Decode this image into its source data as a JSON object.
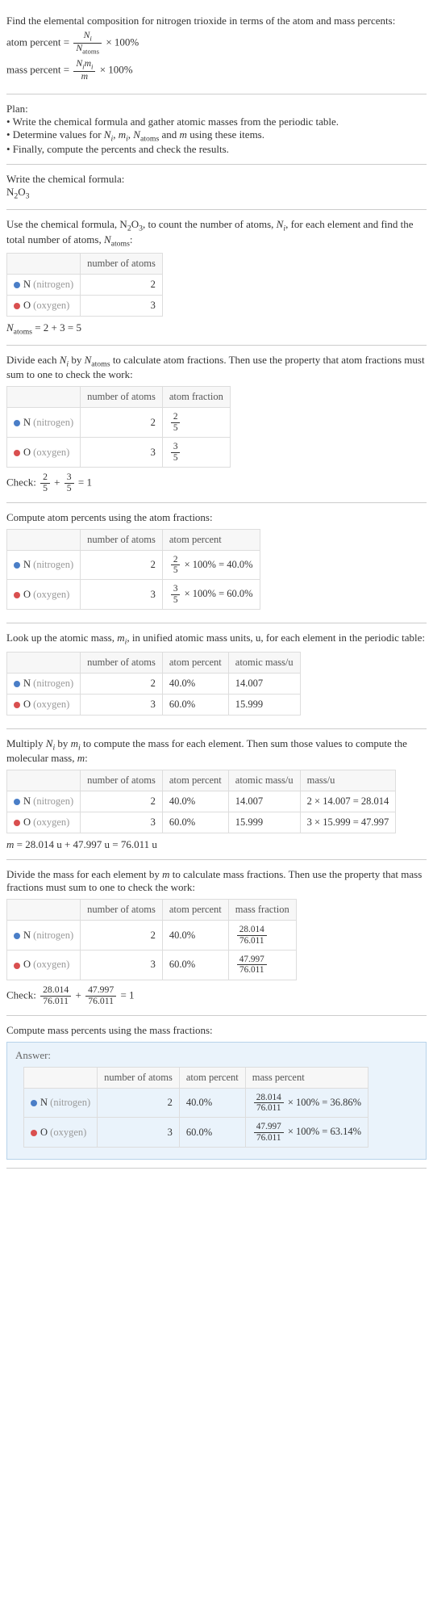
{
  "intro": {
    "line1": "Find the elemental composition for nitrogen trioxide in terms of the atom and mass percents:",
    "atom_percent_label": "atom percent = ",
    "atom_percent_frac_num": "N",
    "atom_percent_frac_den": "N",
    "times_hundred": " × 100%",
    "mass_percent_label": "mass percent = ",
    "mass_percent_frac_num": "N",
    "mass_percent_frac_den": "m"
  },
  "plan": {
    "title": "Plan:",
    "b1": "• Write the chemical formula and gather atomic masses from the periodic table.",
    "b2_a": "• Determine values for ",
    "b2_b": " using these items.",
    "b3": "• Finally, compute the percents and check the results."
  },
  "s1": {
    "title": "Write the chemical formula:",
    "formula_n": "N",
    "formula_n_sub": "2",
    "formula_o": "O",
    "formula_o_sub": "3"
  },
  "s2": {
    "intro_a": "Use the chemical formula, N",
    "intro_b": "O",
    "intro_c": ", to count the number of atoms, ",
    "intro_d": ", for each element and find the total number of atoms, ",
    "intro_e": ":",
    "h_num": "number of atoms",
    "row_n_sym": "N",
    "row_n_name": "(nitrogen)",
    "row_n_val": "2",
    "row_o_sym": "O",
    "row_o_name": "(oxygen)",
    "row_o_val": "3",
    "total_a": " = 2 + 3 = 5"
  },
  "s3": {
    "intro_a": "Divide each ",
    "intro_b": " by ",
    "intro_c": " to calculate atom fractions. Then use the property that atom fractions must sum to one to check the work:",
    "h_num": "number of atoms",
    "h_frac": "atom fraction",
    "row_n_val": "2",
    "row_n_fn": "2",
    "row_n_fd": "5",
    "row_o_val": "3",
    "row_o_fn": "3",
    "row_o_fd": "5",
    "check_label": "Check: ",
    "check_eq": " = 1"
  },
  "s4": {
    "intro": "Compute atom percents using the atom fractions:",
    "h_num": "number of atoms",
    "h_pct": "atom percent",
    "row_n_val": "2",
    "row_n_pct": " × 100% = 40.0%",
    "row_o_val": "3",
    "row_o_pct": " × 100% = 60.0%"
  },
  "s5": {
    "intro_a": "Look up the atomic mass, ",
    "intro_b": ", in unified atomic mass units, u, for each element in the periodic table:",
    "h_num": "number of atoms",
    "h_pct": "atom percent",
    "h_mass": "atomic mass/u",
    "row_n_val": "2",
    "row_n_pct": "40.0%",
    "row_n_mass": "14.007",
    "row_o_val": "3",
    "row_o_pct": "60.0%",
    "row_o_mass": "15.999"
  },
  "s6": {
    "intro_a": "Multiply ",
    "intro_b": " by ",
    "intro_c": " to compute the mass for each element. Then sum those values to compute the molecular mass, ",
    "intro_d": ":",
    "h_num": "number of atoms",
    "h_pct": "atom percent",
    "h_amass": "atomic mass/u",
    "h_massu": "mass/u",
    "row_n_val": "2",
    "row_n_pct": "40.0%",
    "row_n_amass": "14.007",
    "row_n_massu": "2 × 14.007 = 28.014",
    "row_o_val": "3",
    "row_o_pct": "60.0%",
    "row_o_amass": "15.999",
    "row_o_massu": "3 × 15.999 = 47.997",
    "total": " = 28.014 u + 47.997 u = 76.011 u"
  },
  "s7": {
    "intro_a": "Divide the mass for each element by ",
    "intro_b": " to calculate mass fractions. Then use the property that mass fractions must sum to one to check the work:",
    "h_num": "number of atoms",
    "h_pct": "atom percent",
    "h_mfrac": "mass fraction",
    "row_n_val": "2",
    "row_n_pct": "40.0%",
    "row_n_fn": "28.014",
    "row_n_fd": "76.011",
    "row_o_val": "3",
    "row_o_pct": "60.0%",
    "row_o_fn": "47.997",
    "row_o_fd": "76.011",
    "check_label": "Check: ",
    "check_eq": " = 1"
  },
  "s8": {
    "intro": "Compute mass percents using the mass fractions:",
    "answer_title": "Answer:",
    "h_num": "number of atoms",
    "h_apct": "atom percent",
    "h_mpct": "mass percent",
    "row_n_val": "2",
    "row_n_apct": "40.0%",
    "row_n_fn": "28.014",
    "row_n_fd": "76.011",
    "row_n_mres": " × 100% = 36.86%",
    "row_o_val": "3",
    "row_o_apct": "60.0%",
    "row_o_fn": "47.997",
    "row_o_fd": "76.011",
    "row_o_mres": " × 100% = 63.14%"
  },
  "sym": {
    "Ni": "N",
    "i": "i",
    "Natoms": "N",
    "atoms": "atoms",
    "m": "m",
    "mi_m": "m",
    "mi_i": "i",
    "and": " and ",
    "comma": ", "
  },
  "chart_data": {
    "type": "table",
    "title": "Elemental composition of nitrogen trioxide (N2O3)",
    "columns": [
      "element",
      "number_of_atoms",
      "atom_fraction",
      "atom_percent",
      "atomic_mass_u",
      "mass_u",
      "mass_fraction",
      "mass_percent"
    ],
    "rows": [
      {
        "element": "N (nitrogen)",
        "number_of_atoms": 2,
        "atom_fraction": "2/5",
        "atom_percent": 40.0,
        "atomic_mass_u": 14.007,
        "mass_u": 28.014,
        "mass_fraction": "28.014/76.011",
        "mass_percent": 36.86
      },
      {
        "element": "O (oxygen)",
        "number_of_atoms": 3,
        "atom_fraction": "3/5",
        "atom_percent": 60.0,
        "atomic_mass_u": 15.999,
        "mass_u": 47.997,
        "mass_fraction": "47.997/76.011",
        "mass_percent": 63.14
      }
    ],
    "N_atoms_total": 5,
    "molecular_mass_u": 76.011
  }
}
